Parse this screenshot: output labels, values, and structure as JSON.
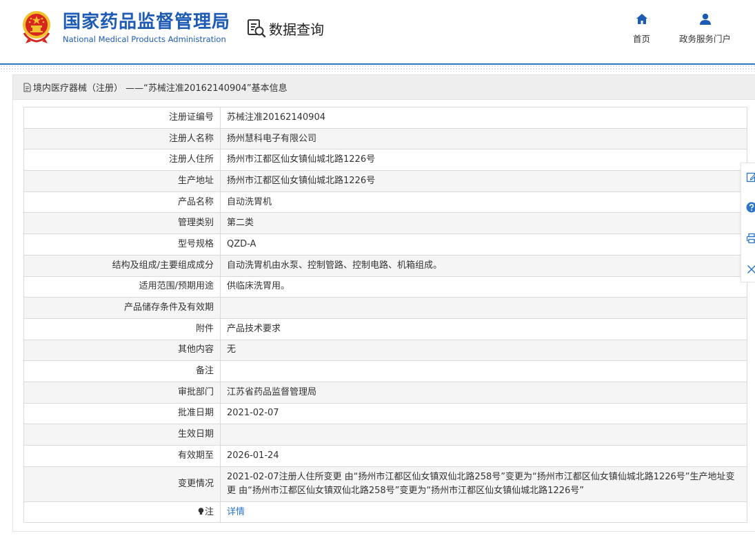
{
  "header": {
    "brand_cn": "国家药品监督管理局",
    "brand_en": "National Medical Products Administration",
    "query_label": "数据查询",
    "nav": {
      "home": "首页",
      "portal": "政务服务门户"
    }
  },
  "panel": {
    "title": "境内医疗器械（注册） ——“苏械注准20162140904”基本信息"
  },
  "rows": [
    {
      "key": "注册证编号",
      "value": "苏械注准20162140904"
    },
    {
      "key": "注册人名称",
      "value": "扬州慧科电子有限公司"
    },
    {
      "key": "注册人住所",
      "value": "扬州市江都区仙女镇仙城北路1226号"
    },
    {
      "key": "生产地址",
      "value": "扬州市江都区仙女镇仙城北路1226号"
    },
    {
      "key": "产品名称",
      "value": "自动洗胃机"
    },
    {
      "key": "管理类别",
      "value": "第二类"
    },
    {
      "key": "型号规格",
      "value": "QZD-A"
    },
    {
      "key": "结构及组成/主要组成成分",
      "value": "自动洗胃机由水泵、控制管路、控制电路、机箱组成。"
    },
    {
      "key": "适用范围/预期用途",
      "value": "供临床洗胃用。"
    },
    {
      "key": "产品储存条件及有效期",
      "value": ""
    },
    {
      "key": "附件",
      "value": "产品技术要求"
    },
    {
      "key": "其他内容",
      "value": "无"
    },
    {
      "key": "备注",
      "value": ""
    },
    {
      "key": "审批部门",
      "value": "江苏省药品监督管理局"
    },
    {
      "key": "批准日期",
      "value": "2021-02-07"
    },
    {
      "key": "生效日期",
      "value": ""
    },
    {
      "key": "有效期至",
      "value": "2026-01-24"
    },
    {
      "key": "变更情况",
      "value": "2021-02-07注册人住所变更 由“扬州市江都区仙女镇双仙北路258号”变更为“扬州市江都区仙女镇仙城北路1226号”生产地址变更 由“扬州市江都区仙女镇双仙北路258号”变更为“扬州市江都区仙女镇仙城北路1226号”"
    },
    {
      "key": "注",
      "value": "详情"
    }
  ],
  "colors": {
    "brand_blue": "#1d5bb4",
    "link_blue": "#2a74c9",
    "emblem_red": "#d7261e",
    "emblem_gold": "#f2c12e"
  },
  "icons": {
    "emblem": "national-emblem-icon",
    "query": "data-query-icon",
    "home": "home-icon",
    "portal": "user-icon",
    "panel": "document-icon",
    "note": "bulb-icon",
    "side": [
      "edit-icon",
      "help-icon",
      "print-icon",
      "close-icon"
    ]
  }
}
